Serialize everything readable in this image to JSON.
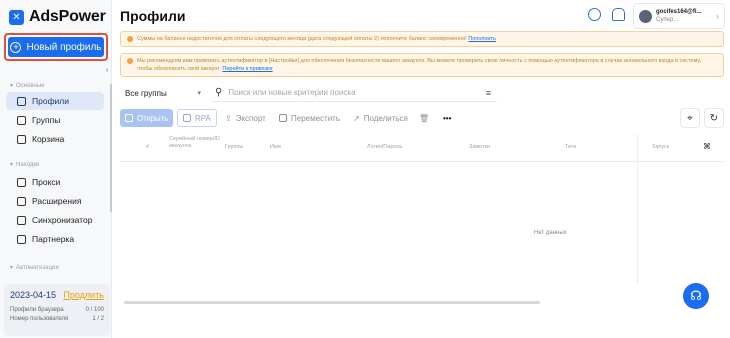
{
  "app": {
    "logo_text": "AdsPower"
  },
  "sidebar": {
    "new_profile_label": "Новый профиль",
    "sections": [
      {
        "label": "Основные"
      },
      {
        "label": "Находки"
      },
      {
        "label": "Автоматизация"
      }
    ],
    "items": [
      {
        "label": "Профили"
      },
      {
        "label": "Группы"
      },
      {
        "label": "Корзина"
      },
      {
        "label": "Прокси"
      },
      {
        "label": "Расширения"
      },
      {
        "label": "Синхронизатор"
      },
      {
        "label": "Партнерка"
      }
    ],
    "footer": {
      "date": "2023-04-15",
      "extend_label": "Продлить",
      "browser_profiles_label": "Профили браузера",
      "browser_profiles_value": "0 / 100",
      "user_number_label": "Номер пользователя",
      "user_number_value": "1 / 2"
    }
  },
  "header": {
    "title": "Профили",
    "user_name": "gocifes164@fi...",
    "user_role": "Супер..."
  },
  "notices": [
    {
      "text": "Суммы на балансе недостаточно для оплаты следующего месяца (дата следующей оплаты 2) пополните баланс своевременно!",
      "link": "Пополнить"
    },
    {
      "text": "Мы рекомендуем вам привязать аутентификатор в [Настройки] для обеспечения безопасности вашего аккаунта. Вы можете проверить свою личность с помощью аутентификатора в случае аномального входа в систему, чтобы обезопасить свой аккаунт.",
      "link": "Перейти к привязке"
    }
  ],
  "toolbar": {
    "group_select": "Все группы",
    "search_placeholder": "Поиск или новые критерии поиска",
    "open_label": "Открыть",
    "rpa_label": "RPA",
    "export_label": "Экспорт",
    "move_label": "Переместить",
    "share_label": "Поделиться"
  },
  "table": {
    "columns": {
      "serial": "Серийный номер/ID аккаунта",
      "group": "Группы",
      "name": "Имя",
      "login": "Логин/Пароль",
      "note": "Заметки",
      "tags": "Теги",
      "launch": "Запуск"
    },
    "empty_text": "Нет данных"
  },
  "colors": {
    "accent": "#1a6cf0",
    "notice_bg": "#fff6e8",
    "highlight_border": "#e0503c"
  }
}
